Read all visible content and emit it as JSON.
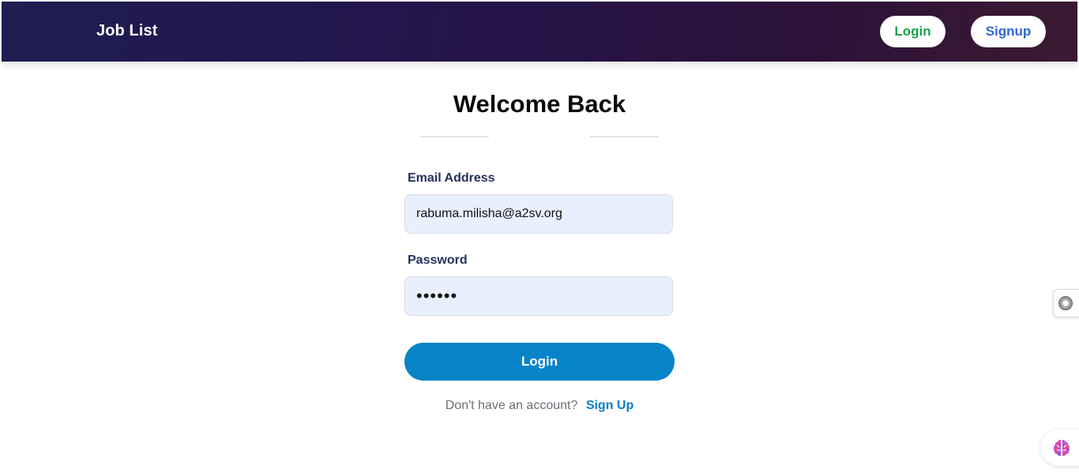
{
  "header": {
    "brand": "Job List",
    "login_label": "Login",
    "signup_label": "Signup",
    "colors": {
      "login": "#17a34a",
      "signup": "#2f66d4",
      "background_start": "#1f1d52",
      "background_end": "#3b1a31"
    }
  },
  "main": {
    "title": "Welcome Back",
    "email": {
      "label": "Email Address",
      "value": "rabuma.milisha@a2sv.org"
    },
    "password": {
      "label": "Password",
      "value": "••••••"
    },
    "login_button": "Login",
    "signup_prompt": "Don't have an account?",
    "signup_link": "Sign Up",
    "colors": {
      "button": "#0784c8",
      "input_background": "#e8f0fe",
      "label": "#25325e"
    }
  },
  "widgets": {
    "side_icon": "extension-disc-icon",
    "assistant_icon": "brain-icon"
  }
}
